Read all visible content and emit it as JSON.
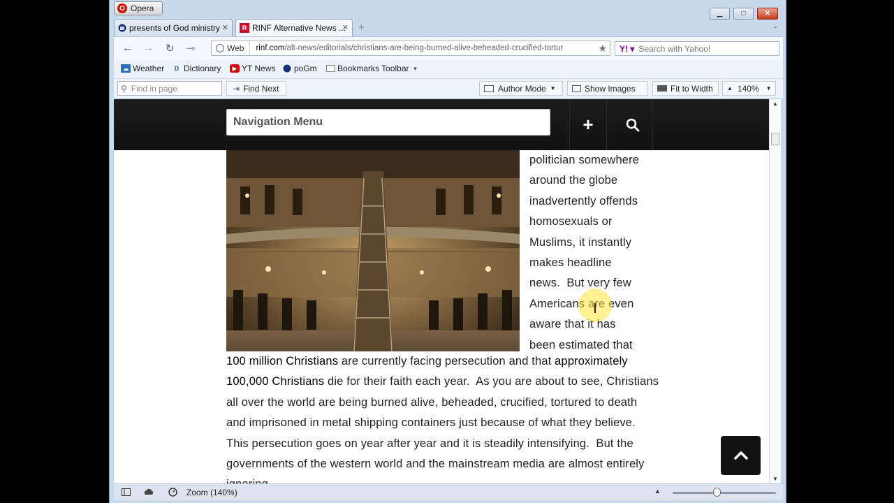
{
  "app": {
    "menu_label": "Opera"
  },
  "tabs": [
    {
      "title": "presents of God ministry"
    },
    {
      "title": "RINF Alternative News ..."
    }
  ],
  "address": {
    "web_label": "Web",
    "url_host": "rinf.com",
    "url_path": "/alt-news/editorials/christians-are-being-burned-alive-beheaded-crucified-tortur"
  },
  "search": {
    "placeholder": "Search with Yahoo!"
  },
  "bookmarks": [
    {
      "label": "Weather"
    },
    {
      "label": "Dictionary"
    },
    {
      "label": "YT News"
    },
    {
      "label": "poGm"
    },
    {
      "label": "Bookmarks Toolbar"
    }
  ],
  "findbar": {
    "find_placeholder": "Find in page",
    "find_next": "Find Next",
    "author_mode": "Author Mode",
    "show_images": "Show Images",
    "fit_to_width": "Fit to Width",
    "zoom": "140%"
  },
  "page": {
    "nav_menu": "Navigation Menu",
    "plus": "+",
    "side_lines": [
      "politician somewhere",
      "around the globe",
      "inadvertently offends",
      "homosexuals or",
      "Muslims, it instantly",
      "makes headline",
      "news.  But very few",
      "Americans are even",
      "aware that it has",
      "been estimated that"
    ],
    "main_text": {
      "em1": "100 million Christians",
      "t1": " are currently facing persecution and that ",
      "em2": "approximately 100,000 Christians",
      "t2": " die for their faith each year.  As you are about to see, Christians all over the world are being burned alive, beheaded, crucified, tortured to death and imprisoned in metal shipping containers just because of what they believe.  This persecution goes on year after year and it is steadily intensifying.  But the governments of the western world and the mainstream media are almost entirely ignoring"
    }
  },
  "status": {
    "zoom": "Zoom (140%)"
  }
}
